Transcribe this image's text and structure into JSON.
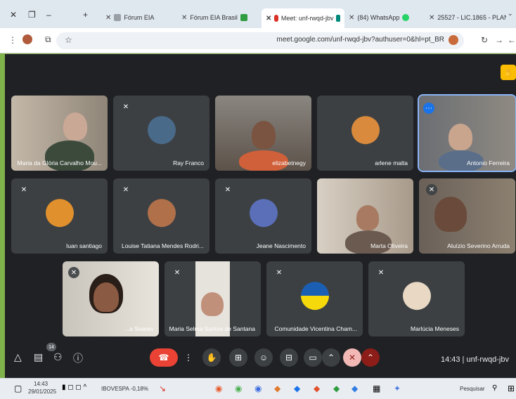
{
  "browser": {
    "tabs": [
      {
        "label": "25527 - LIC.1865 - PLAN"
      },
      {
        "label": "(84) WhatsApp"
      },
      {
        "label": "Meet: unf-rwqd-jbv"
      },
      {
        "label": "Fórum EIA Brasil"
      },
      {
        "label": "Fórum EIA"
      }
    ],
    "url": "meet.google.com/unf-rwqd-jbv?authuser=0&hl=pt_BR"
  },
  "meet": {
    "participants": [
      {
        "name": "Antonio Ferreira"
      },
      {
        "name": "arlene malta"
      },
      {
        "name": "elizabetnegy"
      },
      {
        "name": "Ray Franco"
      },
      {
        "name": "Maria da Glória Carvalho Mou..."
      },
      {
        "name": "Aluízio Severino Arruda"
      },
      {
        "name": "Marta Oliveira"
      },
      {
        "name": "Jeane Nascimento"
      },
      {
        "name": "Louise Tatiana Mendes Rodri..."
      },
      {
        "name": "Iuan santiago"
      },
      {
        "name": "Marlúcia Meneses"
      },
      {
        "name": "Comunidade Vicentina Cham..."
      },
      {
        "name": "Maria Selma Santos de Santana"
      },
      {
        "name": "...a Soares"
      }
    ],
    "meeting_code": "14:43 | unf-rwqd-jbv",
    "participant_count": "14",
    "colors": {
      "hangup": "#ea4335",
      "active_outline": "#8ab4f8",
      "hand": "#fbbc04"
    }
  },
  "taskbar": {
    "search": "Pesquisar",
    "stock": "IBOVESPA -0,18%",
    "time": "14:43",
    "date": "29/01/2025"
  }
}
